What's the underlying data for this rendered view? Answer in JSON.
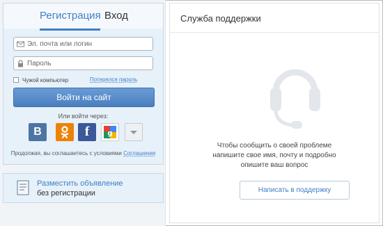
{
  "tabs": {
    "register": "Регистрация",
    "login": "Вход"
  },
  "login_form": {
    "email_placeholder": "Эл. почта или логин",
    "password_placeholder": "Пароль",
    "remember_label": "Чужой компьютер",
    "forgot_link": "Потерялся пароль",
    "submit_label": "Войти на сайт",
    "or_via_label": "Или войти через:",
    "social": [
      {
        "label": "B",
        "icon": "vk-icon",
        "color": "#4c75a3"
      },
      {
        "label": "ok",
        "icon": "odnoklassniki-icon",
        "color": "#ee8208"
      },
      {
        "label": "f",
        "icon": "facebook-icon",
        "color": "#3b5998"
      },
      {
        "label": "g+",
        "icon": "google-plus-icon",
        "color": "#ffffff"
      },
      {
        "label": "more",
        "icon": "chevron-down-icon",
        "color": "#eef1f4"
      }
    ],
    "agree_text": "Продолжая, вы соглашаетесь с условиями",
    "agree_link": "Соглашения"
  },
  "ad": {
    "title": "Разместить объявление",
    "subtitle": "без регистрации"
  },
  "support": {
    "title": "Служба поддержки",
    "text_lines": [
      "Чтобы сообщить о своей проблеме",
      "напишите свое имя, почту и подробно",
      "опишите ваш вопрос"
    ],
    "button_label": "Написать в поддержку"
  },
  "colors": {
    "accent": "#3f7fc5",
    "button": "#4a7fbf",
    "panel_bg": "#e7f1fa"
  }
}
